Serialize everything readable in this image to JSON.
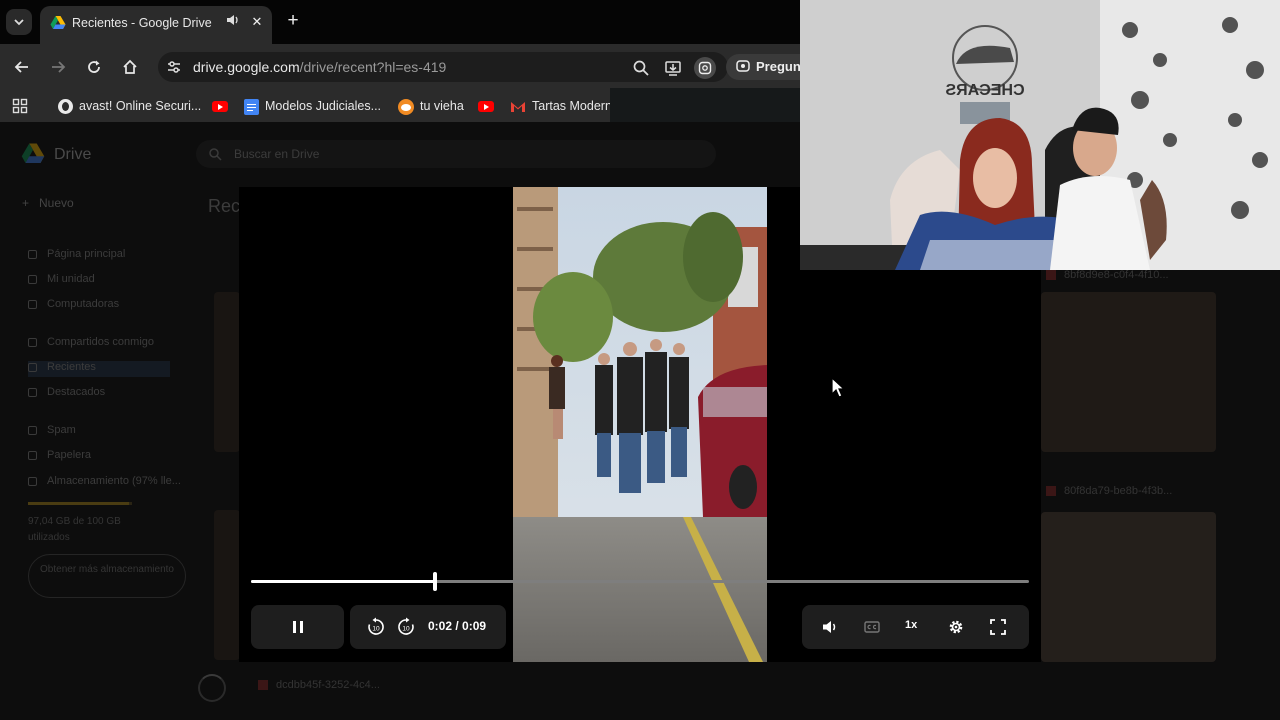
{
  "browser": {
    "tab": {
      "title": "Recientes - Google Drive",
      "favicon": "google-drive-icon",
      "audio_icon": "speaker-icon",
      "close_icon": "close-icon"
    },
    "tab_search_icon": "chevron-down-icon",
    "new_tab_icon": "plus-icon",
    "nav": {
      "back_icon": "back-arrow-icon",
      "forward_icon": "forward-arrow-icon",
      "reload_icon": "reload-icon",
      "home_icon": "home-icon"
    },
    "address": {
      "host": "drive.google.com",
      "path": "/drive/recent?hl=es-419",
      "site_info_icon": "tune-icon"
    },
    "omnibox_actions": [
      "zoom-icon",
      "install-app-icon",
      "lens-icon"
    ],
    "ask_chip_label": "Pregunt",
    "bookmarks": [
      {
        "label": "",
        "icon": "apps-grid-icon"
      },
      {
        "label": "avast! Online Securi...",
        "icon": "avast-icon"
      },
      {
        "label": "",
        "icon": "youtube-icon"
      },
      {
        "label": "Modelos Judiciales...",
        "icon": "docs-icon"
      },
      {
        "label": "tu vieha",
        "icon": "reddit-icon"
      },
      {
        "label": "",
        "icon": "youtube-icon"
      },
      {
        "label": "Tartas Modern",
        "icon": "gmail-icon"
      }
    ]
  },
  "drive": {
    "app_name": "Drive",
    "search_placeholder": "Buscar en Drive",
    "new_button": "Nuevo",
    "heading": "Reci",
    "nav_items": [
      {
        "label": "Página principal"
      },
      {
        "label": "Mi unidad"
      },
      {
        "label": "Computadoras"
      },
      {
        "label": "Compartidos conmigo"
      },
      {
        "label": "Recientes",
        "active": true
      },
      {
        "label": "Destacados"
      },
      {
        "label": "Spam"
      },
      {
        "label": "Papelera"
      },
      {
        "label": "Almacenamiento (97% lle..."
      }
    ],
    "storage_text": "97,04 GB de 100 GB utilizados",
    "storage_fraction": 0.97,
    "storage_button": "Obtener más almacenamiento",
    "files": [
      {
        "name": "8bf8d9e8-c0f4-4f10..."
      },
      {
        "name": "80f8da79-be8b-4f3b..."
      },
      {
        "name": "dcdbb45f-3252-4c4..."
      }
    ]
  },
  "player": {
    "current_time": "0:02",
    "duration": "0:09",
    "time_label": "0:02 / 0:09",
    "progress": 0.236,
    "play_state_icon": "pause-icon",
    "rewind_icon": "rewind-10-icon",
    "forward_icon": "forward-10-icon",
    "volume_icon": "volume-icon",
    "captions_icon": "captions-icon",
    "speed_label": "1x",
    "settings_icon": "gear-icon",
    "fullscreen_icon": "fullscreen-icon"
  },
  "webcam": {
    "wall_logo_text": "CHECARS"
  },
  "colors": {
    "chrome_dark": "#050505",
    "chrome_toolbar": "#2b2b2b",
    "player_bg": "#000000",
    "control_pill": "#1e1e1e",
    "timeline_played": "#ffffff",
    "timeline_track": "#7e7e7e"
  }
}
